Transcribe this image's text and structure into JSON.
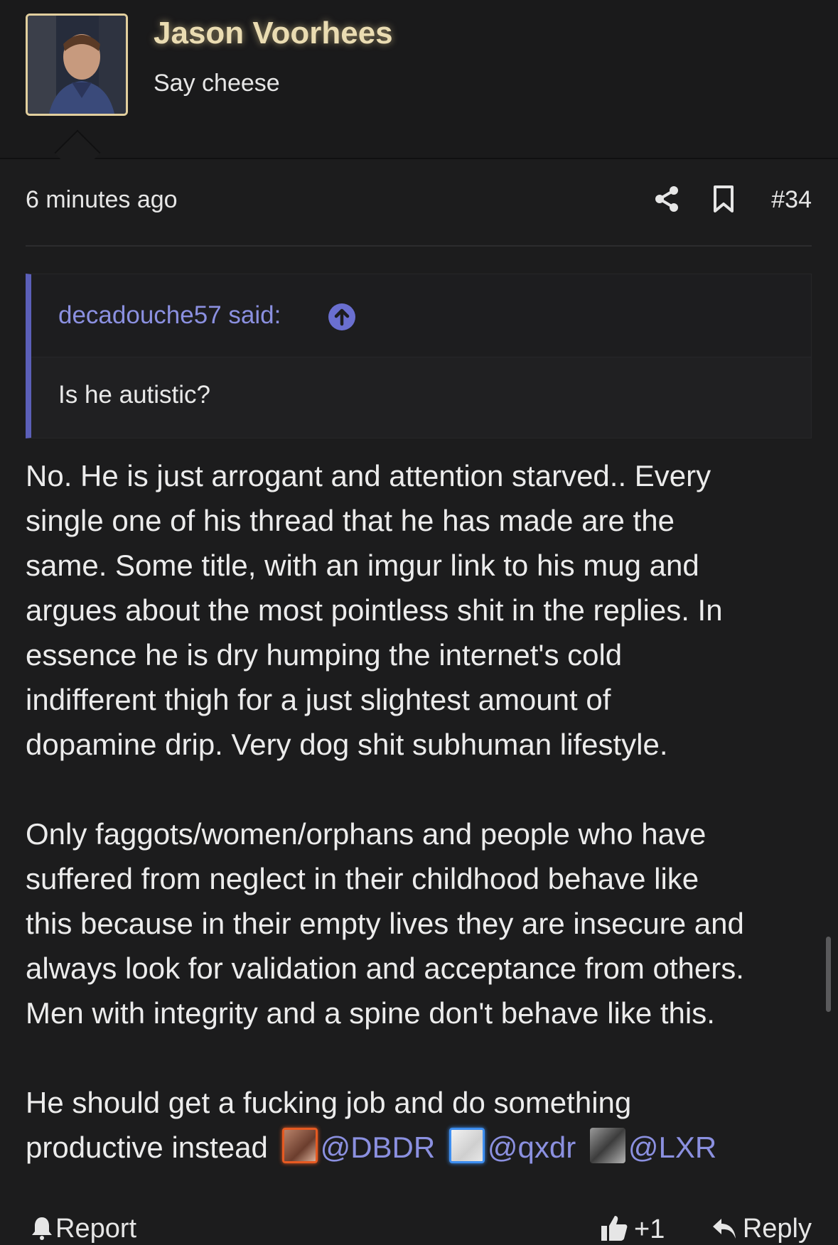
{
  "post": {
    "author": "Jason Voorhees",
    "user_title": "Say cheese",
    "time": "6 minutes ago",
    "number": "#34"
  },
  "quote": {
    "author_said": "decadouche57 said:",
    "text": "Is he autistic?"
  },
  "body": {
    "para1": [
      "No. He is just arrogant and attention starved.. Every",
      "single one of his thread that he has made are the",
      "same. Some title, with an imgur link to his mug and",
      "argues about the most pointless shit in the replies. In",
      "essence he is dry humping the internet's cold",
      "indifferent thigh for a just slightest amount of",
      "dopamine drip. Very dog shit subhuman lifestyle."
    ],
    "para2": [
      "Only faggots/women/orphans and people who have",
      "suffered from neglect in their childhood behave like",
      "this because in their empty lives they are insecure and",
      "always look for validation and acceptance from others.",
      "Men with integrity and a spine don't behave like this."
    ],
    "para3_line1": "He should get a fucking job and do something",
    "para3_line2": "productive instead",
    "mentions": [
      "@DBDR",
      "@qxdr",
      "@LXR"
    ]
  },
  "actions": {
    "report": "Report",
    "like_count": "+1",
    "reply": "Reply"
  },
  "colors": {
    "background": "#1c1c1d",
    "username": "#eadcb2",
    "link": "#8b90e0",
    "quote_bar": "#5b5fb8"
  },
  "icons": [
    "share-icon",
    "bookmark-icon",
    "arrow-up-circle-icon",
    "bell-icon",
    "thumbs-up-icon",
    "reply-arrow-icon"
  ]
}
